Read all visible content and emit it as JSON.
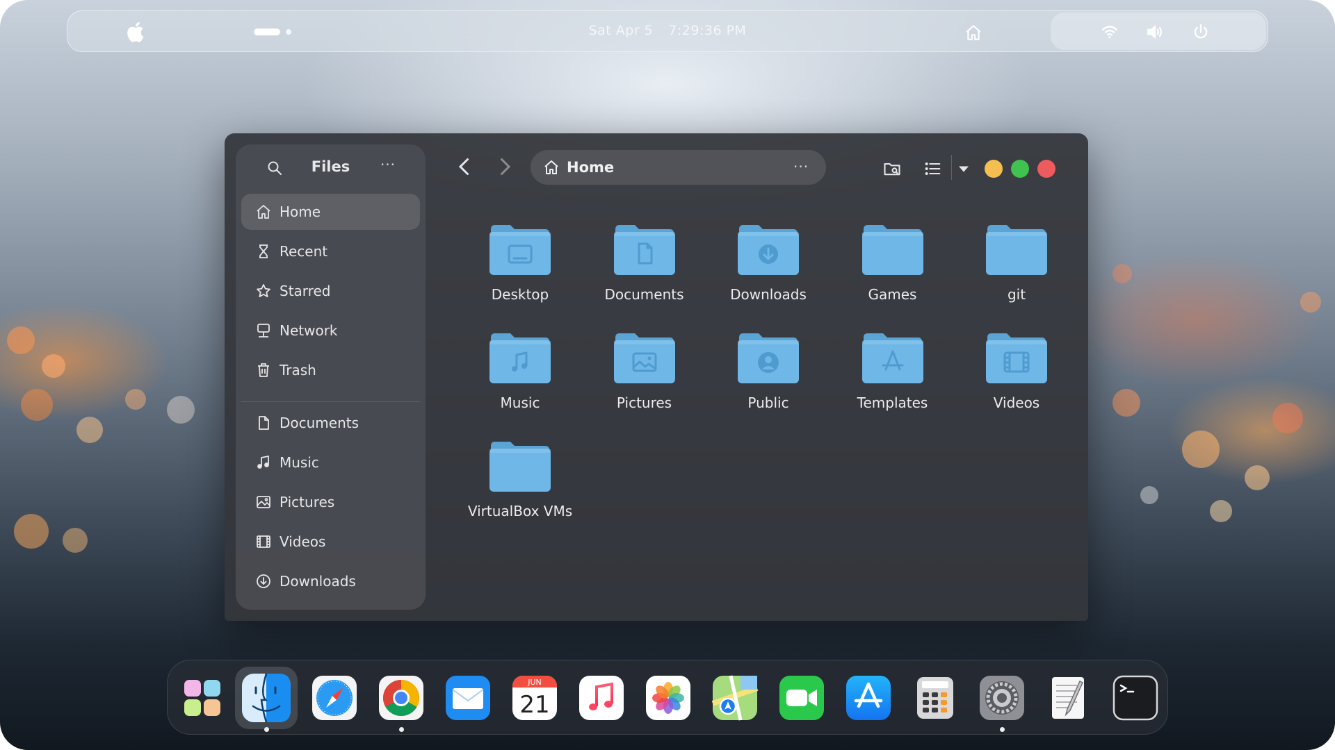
{
  "topbar": {
    "date": "Sat Apr 5",
    "time": "7:29:36 PM",
    "workspaces": 2,
    "active_workspace": 1,
    "icons": [
      "apple-logo-icon",
      "home-icon",
      "wifi-icon",
      "volume-icon",
      "power-icon"
    ]
  },
  "window": {
    "sidebar": {
      "title": "Files",
      "more": "···",
      "places": [
        {
          "label": "Home",
          "icon": "home-icon",
          "active": true
        },
        {
          "label": "Recent",
          "icon": "hourglass-icon"
        },
        {
          "label": "Starred",
          "icon": "star-icon"
        },
        {
          "label": "Network",
          "icon": "network-icon"
        },
        {
          "label": "Trash",
          "icon": "trash-icon"
        }
      ],
      "bookmarks": [
        {
          "label": "Documents",
          "icon": "document-icon"
        },
        {
          "label": "Music",
          "icon": "music-note-icon"
        },
        {
          "label": "Pictures",
          "icon": "picture-icon"
        },
        {
          "label": "Videos",
          "icon": "film-icon"
        },
        {
          "label": "Downloads",
          "icon": "download-icon"
        }
      ]
    },
    "pathbar": {
      "location": "Home",
      "more": "···"
    },
    "colors": {
      "folder": "#6fb7e6",
      "folder_tab": "#5aa4d6",
      "minimize": "#f5be4f",
      "maximize": "#3fc24f",
      "close": "#ee5b5f"
    },
    "files": [
      {
        "label": "Desktop",
        "glyph": "desktop"
      },
      {
        "label": "Documents",
        "glyph": "document"
      },
      {
        "label": "Downloads",
        "glyph": "download"
      },
      {
        "label": "Games",
        "glyph": "none"
      },
      {
        "label": "git",
        "glyph": "none"
      },
      {
        "label": "Music",
        "glyph": "music"
      },
      {
        "label": "Pictures",
        "glyph": "picture"
      },
      {
        "label": "Public",
        "glyph": "person"
      },
      {
        "label": "Templates",
        "glyph": "appstore"
      },
      {
        "label": "Videos",
        "glyph": "film"
      },
      {
        "label": "VirtualBox VMs",
        "glyph": "none"
      }
    ]
  },
  "dock": {
    "calendar": {
      "month": "JUN",
      "day": "21"
    },
    "apps": [
      {
        "name": "launchpad",
        "running": false
      },
      {
        "name": "finder",
        "running": true
      },
      {
        "name": "safari",
        "running": false
      },
      {
        "name": "chrome",
        "running": true
      },
      {
        "name": "mail",
        "running": false
      },
      {
        "name": "calendar",
        "running": false
      },
      {
        "name": "music",
        "running": false
      },
      {
        "name": "photos",
        "running": false
      },
      {
        "name": "maps",
        "running": false
      },
      {
        "name": "facetime",
        "running": false
      },
      {
        "name": "app-store",
        "running": false
      },
      {
        "name": "calculator",
        "running": false
      },
      {
        "name": "system-settings",
        "running": true
      },
      {
        "name": "text-editor",
        "running": false
      },
      {
        "name": "terminal",
        "running": false
      }
    ]
  }
}
